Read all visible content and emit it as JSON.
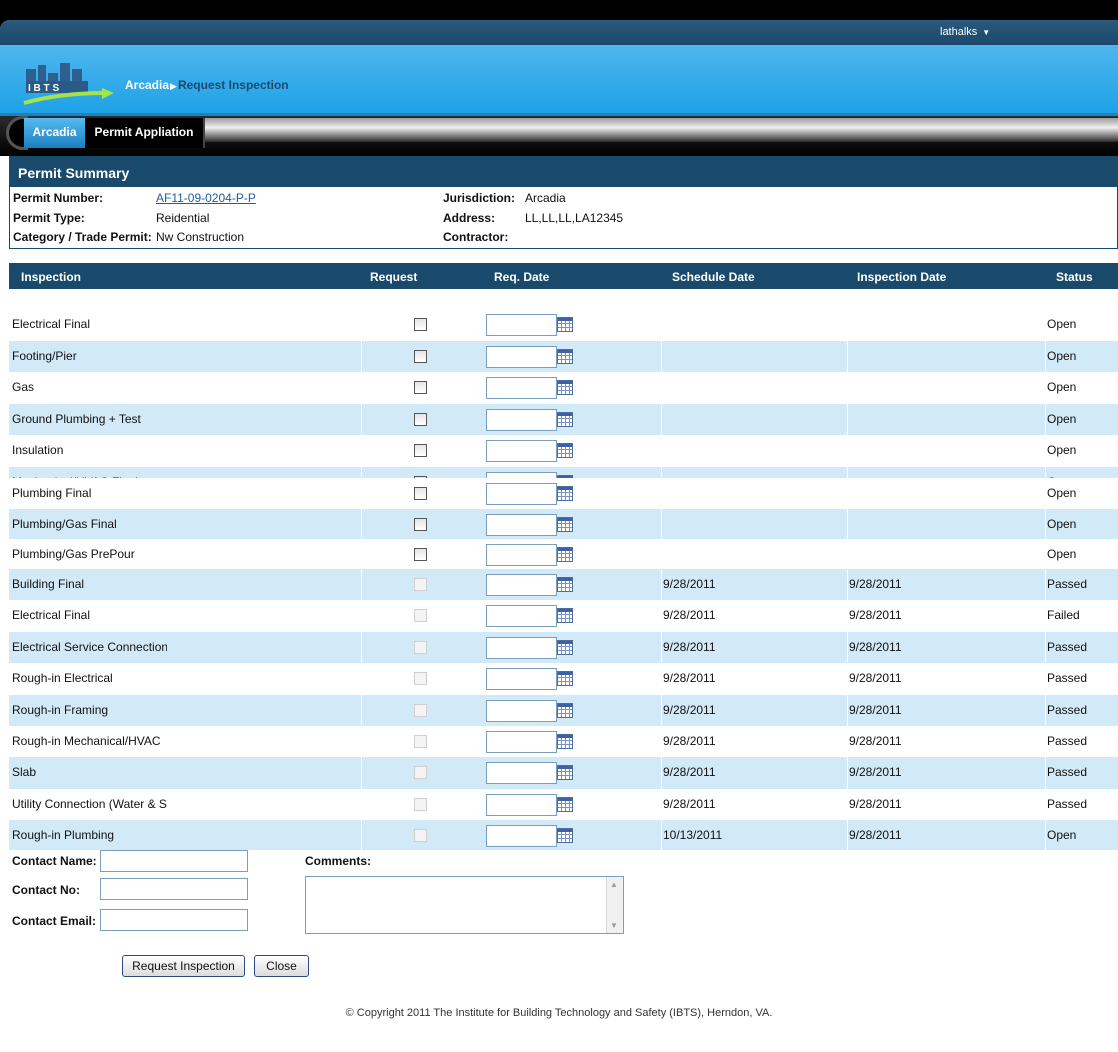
{
  "header": {
    "user": "lathalks",
    "breadcrumb_home": "Arcadia",
    "breadcrumb_current": "Request Inspection",
    "logo_text": "I B T S"
  },
  "nav": {
    "tab_1": "Arcadia",
    "tab_2": "Permit Appliation"
  },
  "summary": {
    "title": "Permit Summary",
    "permit_number_label": "Permit Number:",
    "permit_number": "AF11-09-0204-P-P",
    "permit_type_label": "Permit Type:",
    "permit_type": "Reidential",
    "category_label": "Category / Trade Permit:",
    "category": "Nw Construction",
    "jurisdiction_label": "Jurisdiction:",
    "jurisdiction": "Arcadia",
    "address_label": "Address:",
    "address": "LL,LL,LL,LA12345",
    "contractor_label": "Contractor:"
  },
  "table": {
    "headers": {
      "inspection": "Inspection",
      "request": "Request",
      "req_date": "Req. Date",
      "schedule_date": "Schedule Date",
      "inspection_date": "Inspection Date",
      "status": "Status"
    },
    "rows": [
      {
        "name": "Electrical Final",
        "schedule": "",
        "inspection": "",
        "status": "Open"
      },
      {
        "name": "Footing/Pier",
        "schedule": "",
        "inspection": "",
        "status": "Open"
      },
      {
        "name": "Gas",
        "schedule": "",
        "inspection": "",
        "status": "Open"
      },
      {
        "name": "Ground Plumbing + Test",
        "schedule": "",
        "inspection": "",
        "status": "Open"
      },
      {
        "name": "Insulation",
        "schedule": "",
        "inspection": "",
        "status": "Open"
      },
      {
        "name": "Mechanical/HVAC Final",
        "schedule": "",
        "inspection": "",
        "status": "Open"
      },
      {
        "name": "Plumbing Final",
        "schedule": "",
        "inspection": "",
        "status": "Open"
      },
      {
        "name": "Plumbing/Gas Final",
        "schedule": "",
        "inspection": "",
        "status": "Open"
      },
      {
        "name": "Plumbing/Gas PrePour",
        "schedule": "",
        "inspection": "",
        "status": "Open"
      },
      {
        "name": "Building Final",
        "schedule": "9/28/2011",
        "inspection": "9/28/2011",
        "status": "Passed"
      },
      {
        "name": "Electrical Final",
        "schedule": "9/28/2011",
        "inspection": "9/28/2011",
        "status": "Failed"
      },
      {
        "name": "Electrical Service Connection",
        "schedule": "9/28/2011",
        "inspection": "9/28/2011",
        "status": "Passed"
      },
      {
        "name": "Rough-in Electrical",
        "schedule": "9/28/2011",
        "inspection": "9/28/2011",
        "status": "Passed"
      },
      {
        "name": "Rough-in Framing",
        "schedule": "9/28/2011",
        "inspection": "9/28/2011",
        "status": "Passed"
      },
      {
        "name": "Rough-in Mechanical/HVAC",
        "schedule": "9/28/2011",
        "inspection": "9/28/2011",
        "status": "Passed"
      },
      {
        "name": "Slab",
        "schedule": "9/28/2011",
        "inspection": "9/28/2011",
        "status": "Passed"
      },
      {
        "name": "Utility Connection (Water & Swer)",
        "schedule": "9/28/2011",
        "inspection": "9/28/2011",
        "status": "Passed"
      },
      {
        "name": "Rough-in Plumbing",
        "schedule": "10/13/2011",
        "inspection": "9/28/2011",
        "status": "Open"
      }
    ]
  },
  "form": {
    "contact_name_label": "Contact Name:",
    "contact_no_label": "Contact No:",
    "contact_email_label": "Contact Email:",
    "comments_label": "Comments:",
    "contact_name": "",
    "contact_no": "",
    "contact_email": "",
    "comments": ""
  },
  "buttons": {
    "request": "Request Inspection",
    "close": "Close"
  },
  "footer": {
    "copyright": "© Copyright 2011 The Institute for Building Technology and Safety (IBTS), Herndon, VA."
  }
}
